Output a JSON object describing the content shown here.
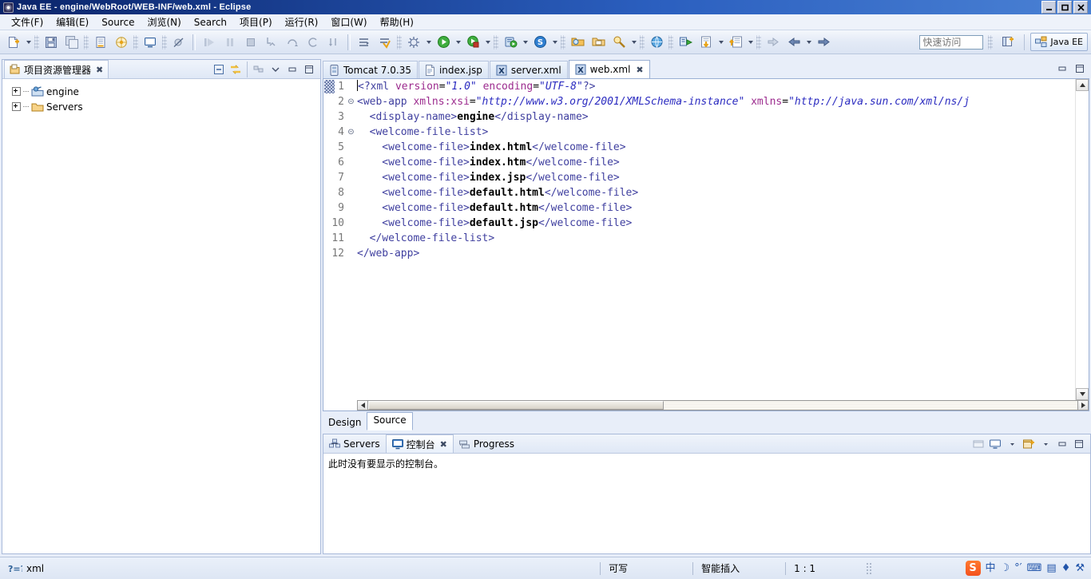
{
  "window": {
    "title": "Java EE - engine/WebRoot/WEB-INF/web.xml - Eclipse",
    "icon": "eclipse-icon",
    "minimize": "–",
    "maximize": "❐",
    "close": "✕"
  },
  "menu": {
    "items": [
      {
        "label": "文件(F)",
        "name": "menu-file"
      },
      {
        "label": "编辑(E)",
        "name": "menu-edit"
      },
      {
        "label": "Source",
        "name": "menu-source"
      },
      {
        "label": "浏览(N)",
        "name": "menu-navigate"
      },
      {
        "label": "Search",
        "name": "menu-search"
      },
      {
        "label": "项目(P)",
        "name": "menu-project"
      },
      {
        "label": "运行(R)",
        "name": "menu-run"
      },
      {
        "label": "窗口(W)",
        "name": "menu-window"
      },
      {
        "label": "帮助(H)",
        "name": "menu-help"
      }
    ]
  },
  "toolbar": {
    "quick_access_placeholder": "快速访问",
    "quick_access_value": "",
    "open_perspective_title": "打开透视图",
    "perspective_label": "Java EE"
  },
  "project_explorer": {
    "tab_label": "项目资源管理器",
    "tab_icon": "project-explorer-icon",
    "close_label": "✖",
    "tree": [
      {
        "label": "engine",
        "icon": "java-project-icon"
      },
      {
        "label": "Servers",
        "icon": "folder-icon"
      }
    ]
  },
  "editor": {
    "tabs": [
      {
        "label": "Tomcat 7.0.35",
        "icon": "server-icon",
        "active": false,
        "closable": false
      },
      {
        "label": "index.jsp",
        "icon": "jsp-file-icon",
        "active": false,
        "closable": false
      },
      {
        "label": "server.xml",
        "icon": "xml-file-icon",
        "active": false,
        "closable": false
      },
      {
        "label": "web.xml",
        "icon": "xml-file-icon",
        "active": true,
        "closable": true
      }
    ],
    "close_glyph": "✖",
    "bottom_tabs": [
      {
        "label": "Design",
        "active": false
      },
      {
        "label": "Source",
        "active": true
      }
    ],
    "lines": [
      {
        "num": "1",
        "fold": "",
        "current": true,
        "tokens": [
          {
            "t": "caret",
            "v": ""
          },
          {
            "t": "pi",
            "v": "<?xml "
          },
          {
            "t": "attr",
            "v": "version"
          },
          {
            "t": "eq",
            "v": "="
          },
          {
            "t": "val",
            "v": "\"1.0\""
          },
          {
            "t": "pi",
            "v": " "
          },
          {
            "t": "attr",
            "v": "encoding"
          },
          {
            "t": "eq",
            "v": "="
          },
          {
            "t": "val",
            "v": "\"UTF-8\""
          },
          {
            "t": "pi",
            "v": "?>"
          }
        ]
      },
      {
        "num": "2",
        "fold": "⊝",
        "current": false,
        "tokens": [
          {
            "t": "tag",
            "v": "<web-app "
          },
          {
            "t": "attr",
            "v": "xmlns:xsi"
          },
          {
            "t": "eq",
            "v": "="
          },
          {
            "t": "val",
            "v": "\"http://www.w3.org/2001/XMLSchema-instance\""
          },
          {
            "t": "eq",
            "v": " "
          },
          {
            "t": "attr",
            "v": "xmlns"
          },
          {
            "t": "eq",
            "v": "="
          },
          {
            "t": "val",
            "v": "\"http://java.sun.com/xml/ns/j"
          }
        ]
      },
      {
        "num": "3",
        "fold": "",
        "current": false,
        "tokens": [
          {
            "t": "tag",
            "v": "  <display-name>"
          },
          {
            "t": "txt",
            "v": "engine"
          },
          {
            "t": "tag",
            "v": "</display-name>"
          }
        ]
      },
      {
        "num": "4",
        "fold": "⊝",
        "current": false,
        "tokens": [
          {
            "t": "tag",
            "v": "  <welcome-file-list>"
          }
        ]
      },
      {
        "num": "5",
        "fold": "",
        "current": false,
        "tokens": [
          {
            "t": "tag",
            "v": "    <welcome-file>"
          },
          {
            "t": "txt",
            "v": "index.html"
          },
          {
            "t": "tag",
            "v": "</welcome-file>"
          }
        ]
      },
      {
        "num": "6",
        "fold": "",
        "current": false,
        "tokens": [
          {
            "t": "tag",
            "v": "    <welcome-file>"
          },
          {
            "t": "txt",
            "v": "index.htm"
          },
          {
            "t": "tag",
            "v": "</welcome-file>"
          }
        ]
      },
      {
        "num": "7",
        "fold": "",
        "current": false,
        "tokens": [
          {
            "t": "tag",
            "v": "    <welcome-file>"
          },
          {
            "t": "txt",
            "v": "index.jsp"
          },
          {
            "t": "tag",
            "v": "</welcome-file>"
          }
        ]
      },
      {
        "num": "8",
        "fold": "",
        "current": false,
        "tokens": [
          {
            "t": "tag",
            "v": "    <welcome-file>"
          },
          {
            "t": "txt",
            "v": "default.html"
          },
          {
            "t": "tag",
            "v": "</welcome-file>"
          }
        ]
      },
      {
        "num": "9",
        "fold": "",
        "current": false,
        "tokens": [
          {
            "t": "tag",
            "v": "    <welcome-file>"
          },
          {
            "t": "txt",
            "v": "default.htm"
          },
          {
            "t": "tag",
            "v": "</welcome-file>"
          }
        ]
      },
      {
        "num": "10",
        "fold": "",
        "current": false,
        "tokens": [
          {
            "t": "tag",
            "v": "    <welcome-file>"
          },
          {
            "t": "txt",
            "v": "default.jsp"
          },
          {
            "t": "tag",
            "v": "</welcome-file>"
          }
        ]
      },
      {
        "num": "11",
        "fold": "",
        "current": false,
        "tokens": [
          {
            "t": "tag",
            "v": "  </welcome-file-list>"
          }
        ]
      },
      {
        "num": "12",
        "fold": "",
        "current": false,
        "tokens": [
          {
            "t": "tag",
            "v": "</web-app>"
          }
        ]
      }
    ]
  },
  "console_panel": {
    "tabs": [
      {
        "label": "Servers",
        "icon": "servers-icon",
        "active": false,
        "closable": false
      },
      {
        "label": "控制台",
        "icon": "console-icon",
        "active": true,
        "closable": true
      },
      {
        "label": "Progress",
        "icon": "progress-icon",
        "active": false,
        "closable": false
      }
    ],
    "close_glyph": "✖",
    "message": "此时没有要显示的控制台。"
  },
  "statusbar": {
    "content_type": "xml",
    "content_type_icon": "xml-status-icon",
    "writable": "可写",
    "insert_mode": "智能插入",
    "position": "1 : 1",
    "tray": {
      "sogou": "S",
      "lang": "中",
      "moon": "☽",
      "degree": "°′",
      "keyboard": "⌨",
      "toolbox": "▤",
      "shirt": "♦",
      "wrench": "⚒"
    }
  },
  "colors": {
    "title_start": "#0a246a",
    "title_end": "#4a81d4",
    "tag": "#3f3f9f",
    "attr": "#9c2b8e",
    "value": "#2b2bc0",
    "text": "#000000",
    "panel_bg": "#e8eef9",
    "accent": "#2b5fbf"
  }
}
